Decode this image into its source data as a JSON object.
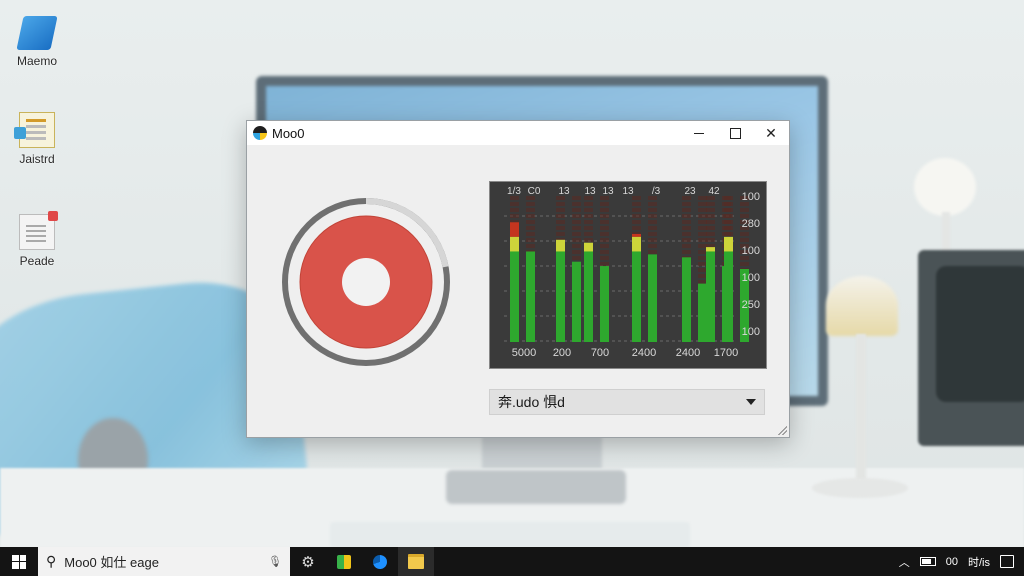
{
  "desktop": {
    "icons": [
      {
        "label": "Maemo",
        "icon": "app-shortcut-icon"
      },
      {
        "label": "Jaistrd",
        "icon": "notepad-document-icon"
      },
      {
        "label": "Peade",
        "icon": "document-file-icon"
      }
    ]
  },
  "window": {
    "title": "Moo0",
    "controls": {
      "minimize": "minimize",
      "maximize": "maximize",
      "close": "close"
    },
    "recorder": {
      "state_icon": "record-button-icon",
      "progress": 0.78,
      "accent": "#d9534a"
    },
    "meter": {
      "type": "bar",
      "top_labels": [
        "1/3",
        "C0",
        "13",
        "13",
        "13",
        "13",
        "/3",
        "23",
        "42"
      ],
      "scale_labels": [
        "100",
        "280",
        "100",
        "100",
        "250",
        "100"
      ],
      "bottom_labels": [
        "5000",
        "200",
        "700",
        "2400",
        "2400",
        "1700"
      ],
      "levels": [
        0.82,
        0.62,
        0.7,
        0.55,
        0.68,
        0.52,
        0.74,
        0.6,
        0.58,
        0.4,
        0.65,
        0.52,
        0.72,
        0.5
      ],
      "colors": {
        "green": "#2ea82e",
        "yellow": "#cdd43a",
        "red": "#c4351f"
      }
    },
    "dropdown": {
      "value": "奔.udo 惧d"
    }
  },
  "taskbar": {
    "search_text": "Moo0 如仕 eage",
    "tray_time": "00",
    "tray_date": "时/is"
  }
}
